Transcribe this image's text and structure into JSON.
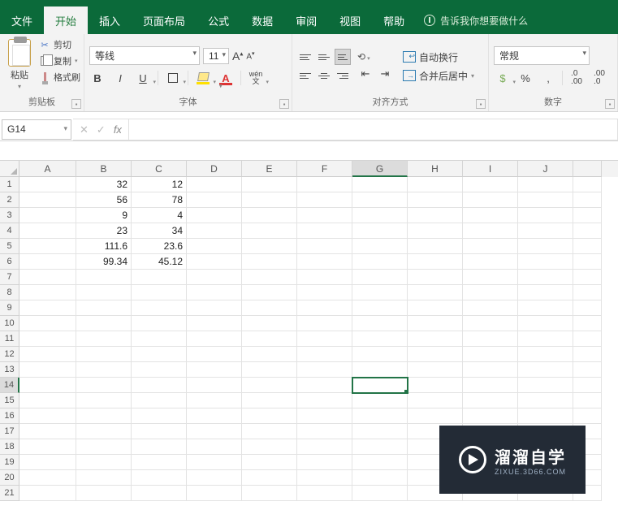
{
  "tabs": {
    "file": "文件",
    "home": "开始",
    "insert": "插入",
    "layout": "页面布局",
    "formulas": "公式",
    "data": "数据",
    "review": "审阅",
    "view": "视图",
    "help": "帮助",
    "tellme": "告诉我你想要做什么"
  },
  "ribbon": {
    "clipboard": {
      "label": "剪贴板",
      "paste": "粘贴",
      "cut": "剪切",
      "copy": "复制",
      "painter": "格式刷"
    },
    "font": {
      "label": "字体",
      "name": "等线",
      "size": "11"
    },
    "align": {
      "label": "对齐方式",
      "wrap": "自动换行",
      "merge": "合并后居中"
    },
    "number": {
      "label": "数字",
      "format": "常规"
    }
  },
  "formula_bar": {
    "namebox": "G14"
  },
  "grid": {
    "columns": [
      "A",
      "B",
      "C",
      "D",
      "E",
      "F",
      "G",
      "H",
      "I",
      "J"
    ],
    "rows": [
      "1",
      "2",
      "3",
      "4",
      "5",
      "6",
      "7",
      "8",
      "9",
      "10",
      "11",
      "12",
      "13",
      "14",
      "15",
      "16",
      "17",
      "18",
      "19",
      "20",
      "21"
    ],
    "active": {
      "row": 14,
      "col": "G"
    },
    "cells": {
      "B1": "32",
      "C1": "12",
      "B2": "56",
      "C2": "78",
      "B3": "9",
      "C3": "4",
      "B4": "23",
      "C4": "34",
      "B5": "111.6",
      "C5": "23.6",
      "B6": "99.34",
      "C6": "45.12"
    }
  },
  "watermark": {
    "main": "溜溜自学",
    "sub": "ZIXUE.3D66.COM"
  }
}
